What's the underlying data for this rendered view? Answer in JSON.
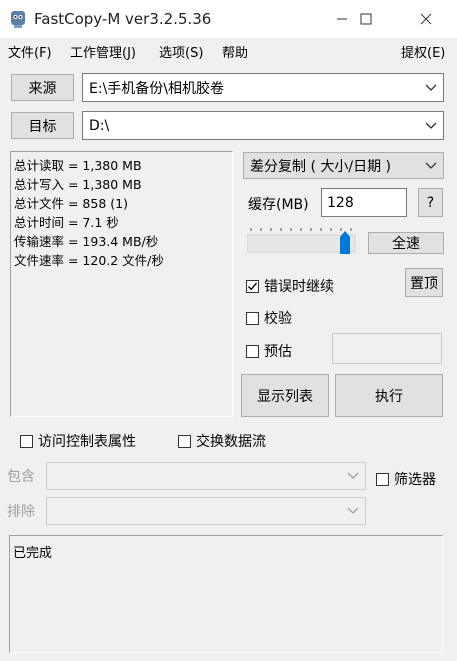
{
  "window": {
    "title": "FastCopy-M ver3.2.5.36",
    "minimize_icon": "minimize-icon",
    "maximize_icon": "maximize-icon",
    "close_icon": "close-icon"
  },
  "menu": {
    "file": "文件(F)",
    "job": "工作管理(J)",
    "options": "选项(S)",
    "help": "帮助",
    "elevate": "提权(E)"
  },
  "source": {
    "button": "来源",
    "path": "E:\\手机备份\\相机胶卷"
  },
  "target": {
    "button": "目标",
    "path": "D:\\"
  },
  "stats": [
    "总计读取 = 1,380 MB",
    "总计写入 = 1,380 MB",
    "总计文件 = 858 (1)",
    "总计时间 = 7.1 秒",
    "传输速率 = 193.4 MB/秒",
    "文件速率 = 120.2 文件/秒"
  ],
  "mode": {
    "selected": "差分复制 ( 大小/日期 )"
  },
  "buffer": {
    "label": "缓存(MB)",
    "value": "128",
    "help_button": "?"
  },
  "speed": {
    "button": "全速",
    "slider_fraction": 1.0
  },
  "options": {
    "continue_on_error": {
      "label": "错误时继续",
      "checked": true
    },
    "verify": {
      "label": "校验",
      "checked": false
    },
    "estimate": {
      "label": "预估",
      "checked": false
    }
  },
  "top_button": "置顶",
  "list_button": "显示列表",
  "execute_button": "执行",
  "acl": {
    "label": "访问控制表属性",
    "checked": false
  },
  "ads": {
    "label": "交换数据流",
    "checked": false
  },
  "filter": {
    "include_label": "包含",
    "exclude_label": "排除",
    "filter_label": "筛选器",
    "checked": false
  },
  "status": {
    "text": "已完成"
  }
}
